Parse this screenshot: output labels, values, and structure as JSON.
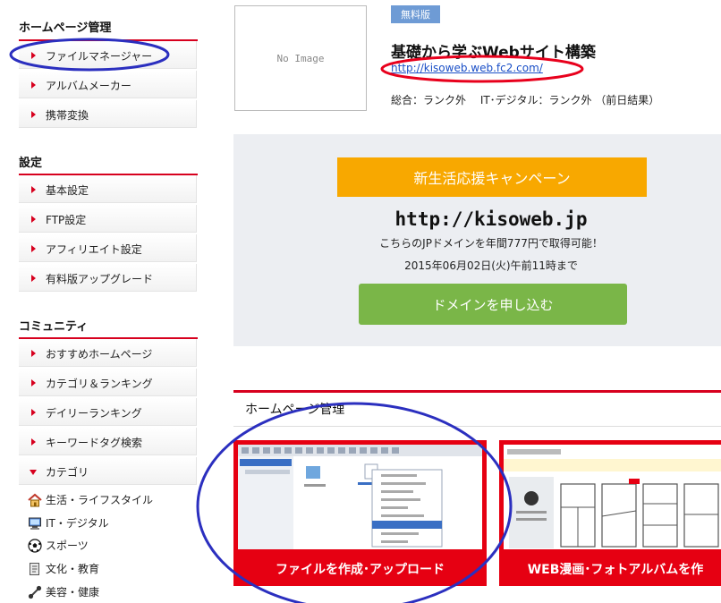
{
  "sidebar": {
    "sections": [
      {
        "title": "ホームページ管理",
        "items": [
          "ファイルマネージャー",
          "アルバムメーカー",
          "携帯変換"
        ]
      },
      {
        "title": "設定",
        "items": [
          "基本設定",
          "FTP設定",
          "アフィリエイト設定",
          "有料版アップグレード"
        ]
      },
      {
        "title": "コミュニティ",
        "items": [
          "おすすめホームページ",
          "カテゴリ＆ランキング",
          "デイリーランキング",
          "キーワードタグ検索",
          "カテゴリ"
        ]
      }
    ],
    "categories": [
      {
        "label": "生活・ライフスタイル",
        "icon": "house-icon"
      },
      {
        "label": "IT・デジタル",
        "icon": "computer-icon"
      },
      {
        "label": "スポーツ",
        "icon": "soccer-ball-icon"
      },
      {
        "label": "文化・教育",
        "icon": "book-icon"
      },
      {
        "label": "美容・健康",
        "icon": "dumbbell-icon"
      }
    ]
  },
  "site": {
    "no_image": "No Image",
    "badge": "無料版",
    "title": "基礎から学ぶWebサイト構築",
    "url": "http://kisoweb.web.fc2.com/",
    "rank": "総合：ランク外　 IT･デジタル：ランク外 （前日結果）"
  },
  "promo": {
    "banner": "新生活応援キャンペーン",
    "domain": "http://kisoweb.jp",
    "desc": "こちらのJPドメインを年間777円で取得可能！",
    "date": "2015年06月02日(火)午前11時まで",
    "button": "ドメインを申し込む"
  },
  "hp": {
    "title": "ホームページ管理",
    "cards": [
      {
        "caption": "ファイルを作成･アップロード"
      },
      {
        "caption": "WEB漫画･フォトアルバムを作"
      }
    ]
  },
  "colors": {
    "accent": "#d7001e",
    "promo_banner": "#f8a800",
    "promo_button": "#7ab648",
    "annotation": "#2b2fbf",
    "annotation_red": "#e8001c"
  }
}
